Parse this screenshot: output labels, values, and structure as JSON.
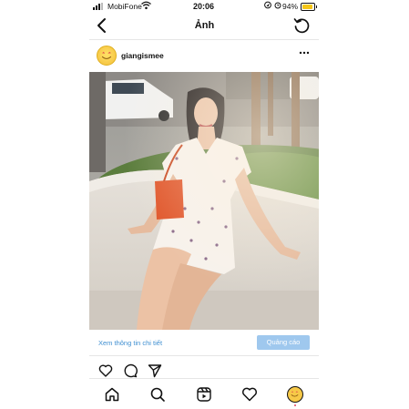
{
  "status_bar": {
    "carrier": "MobiFone",
    "time": "20:06",
    "battery_percent": "94%",
    "battery_level": 0.94,
    "icons": [
      "signal-icon",
      "wifi-icon",
      "location-icon",
      "alarm-icon",
      "battery-icon"
    ]
  },
  "nav": {
    "title": "Ảnh",
    "back_icon": "chevron-left-icon",
    "refresh_icon": "refresh-icon"
  },
  "post": {
    "username": "giangismee",
    "more_icon": "more-horizontal-icon",
    "photo_description_icon": "photo-icon",
    "details_link": "Xem thông tin chi tiết",
    "ad_label": "Quảng cáo"
  },
  "actions": [
    "like-heart-icon",
    "comment-icon",
    "share-icon"
  ],
  "tabs": [
    "home-icon",
    "search-icon",
    "reels-icon",
    "activity-heart-icon",
    "profile-avatar-icon"
  ],
  "colors": {
    "link": "#3f8fd1",
    "ad_badge": "#9fc8ee",
    "battery": "#f5c518",
    "avatar": "#f7c948",
    "notification_dot": "#e4405f"
  }
}
